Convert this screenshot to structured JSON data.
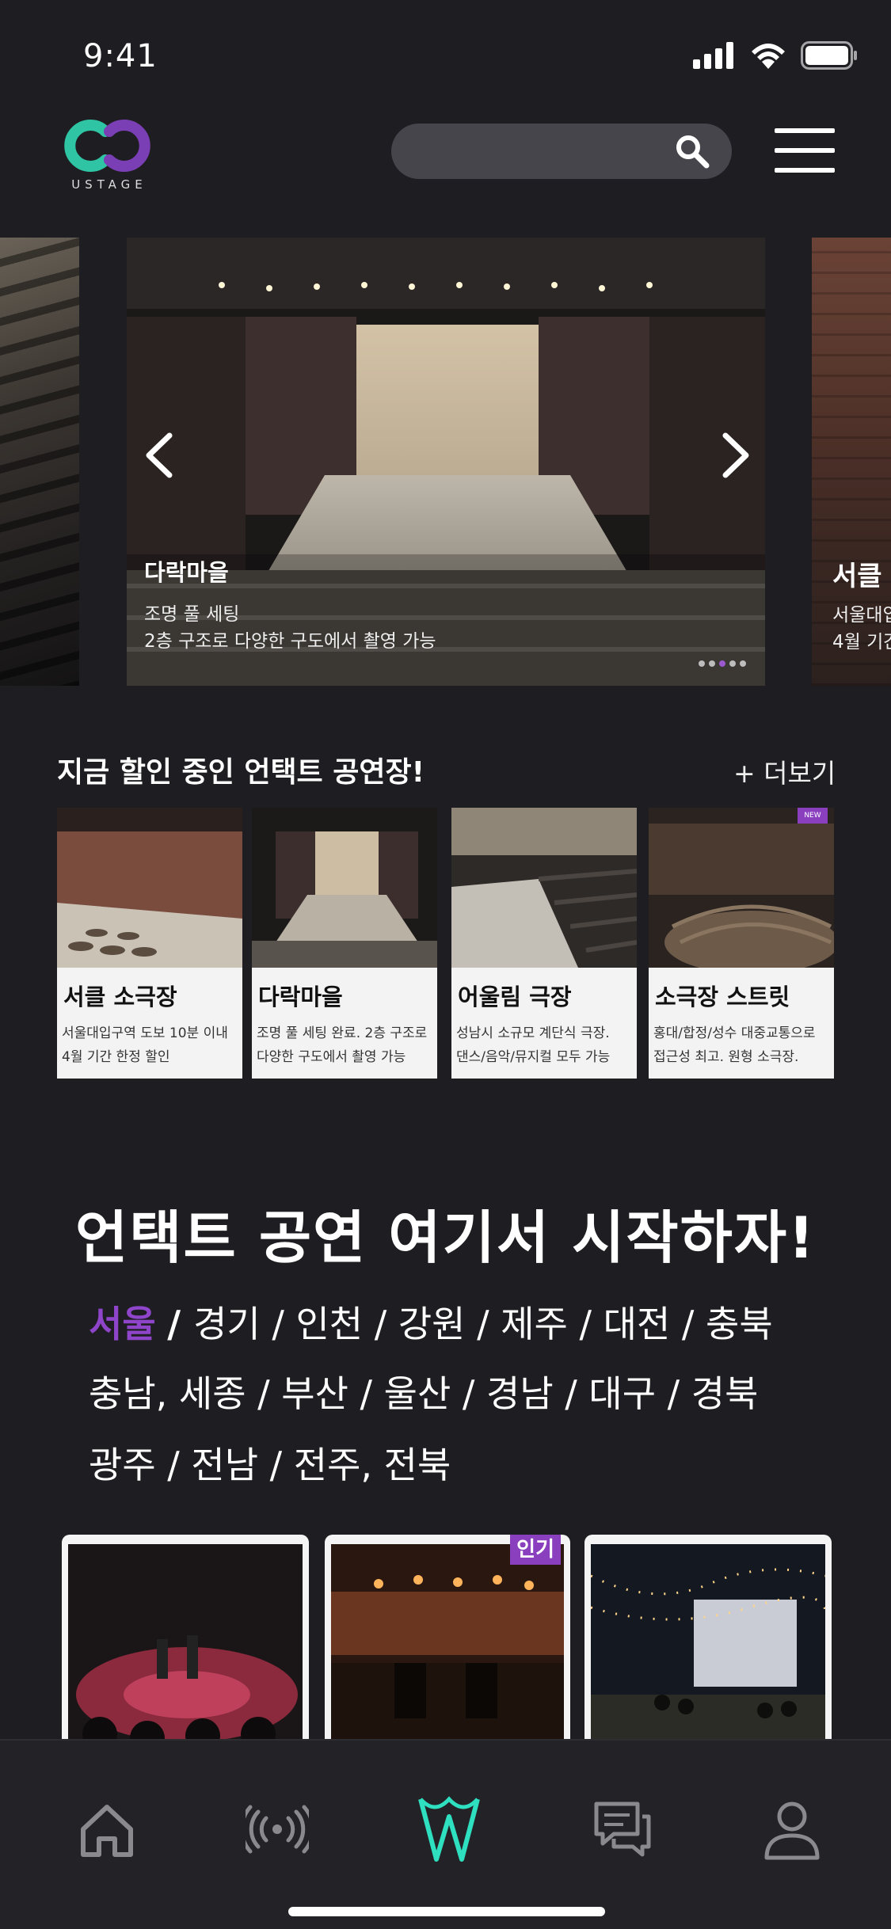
{
  "status_bar": {
    "time": "9:41"
  },
  "header": {
    "logo_text": "USTAGE",
    "search_placeholder": "",
    "colors": {
      "logo_teal": "#2ec4a4",
      "logo_purple": "#7b3fb5",
      "search_bg": "#46454b"
    }
  },
  "hero": {
    "title": "다락마을",
    "subtitle1": "조명 풀 세팅",
    "subtitle2": "2층 구조로 다양한 구도에서 촬영 가능",
    "next_title": "서클",
    "next_sub1": "서울대입",
    "next_sub2": "4월 기간",
    "dot_count": 5,
    "active_dot": 3
  },
  "discount_section": {
    "title": "지금 할인 중인 언택트 공연장!",
    "more_label": "+ 더보기",
    "cards": [
      {
        "name": "서클 소극장",
        "desc1": "서울대입구역 도보 10분 이내",
        "desc2": "4월 기간 한정 할인"
      },
      {
        "name": "다락마을",
        "desc1": "조명 풀 세팅 완료. 2층 구조로",
        "desc2": "다양한 구도에서 촬영 가능"
      },
      {
        "name": "어울림 극장",
        "desc1": "성남시 소규모 계단식 극장.",
        "desc2": "댄스/음악/뮤지컬 모두 가능"
      },
      {
        "name": "소극장 스트릿",
        "desc1": "홍대/합정/성수 대중교통으로",
        "desc2": "접근성 최고. 원형 소극장.",
        "badge": "NEW"
      }
    ]
  },
  "region_section": {
    "title": "언택트 공연 여기서 시작하자!",
    "selected": "서울",
    "line1_rest": "경기 / 인천 / 강원 / 제주 / 대전 / 충북",
    "line2": "충남, 세종 /  부산 / 울산 / 경남 / 대구 / 경북",
    "line3": "광주 / 전남 / 전주, 전북",
    "accent_color": "#8e45c9"
  },
  "venue_tiles": [
    {
      "badge": ""
    },
    {
      "badge": "인기"
    },
    {
      "badge": ""
    }
  ],
  "bottom_nav": {
    "items": [
      "home-icon",
      "broadcast-icon",
      "stage-icon",
      "chat-icon",
      "profile-icon"
    ],
    "active": "stage-icon",
    "active_color": "#2ee0c0"
  }
}
